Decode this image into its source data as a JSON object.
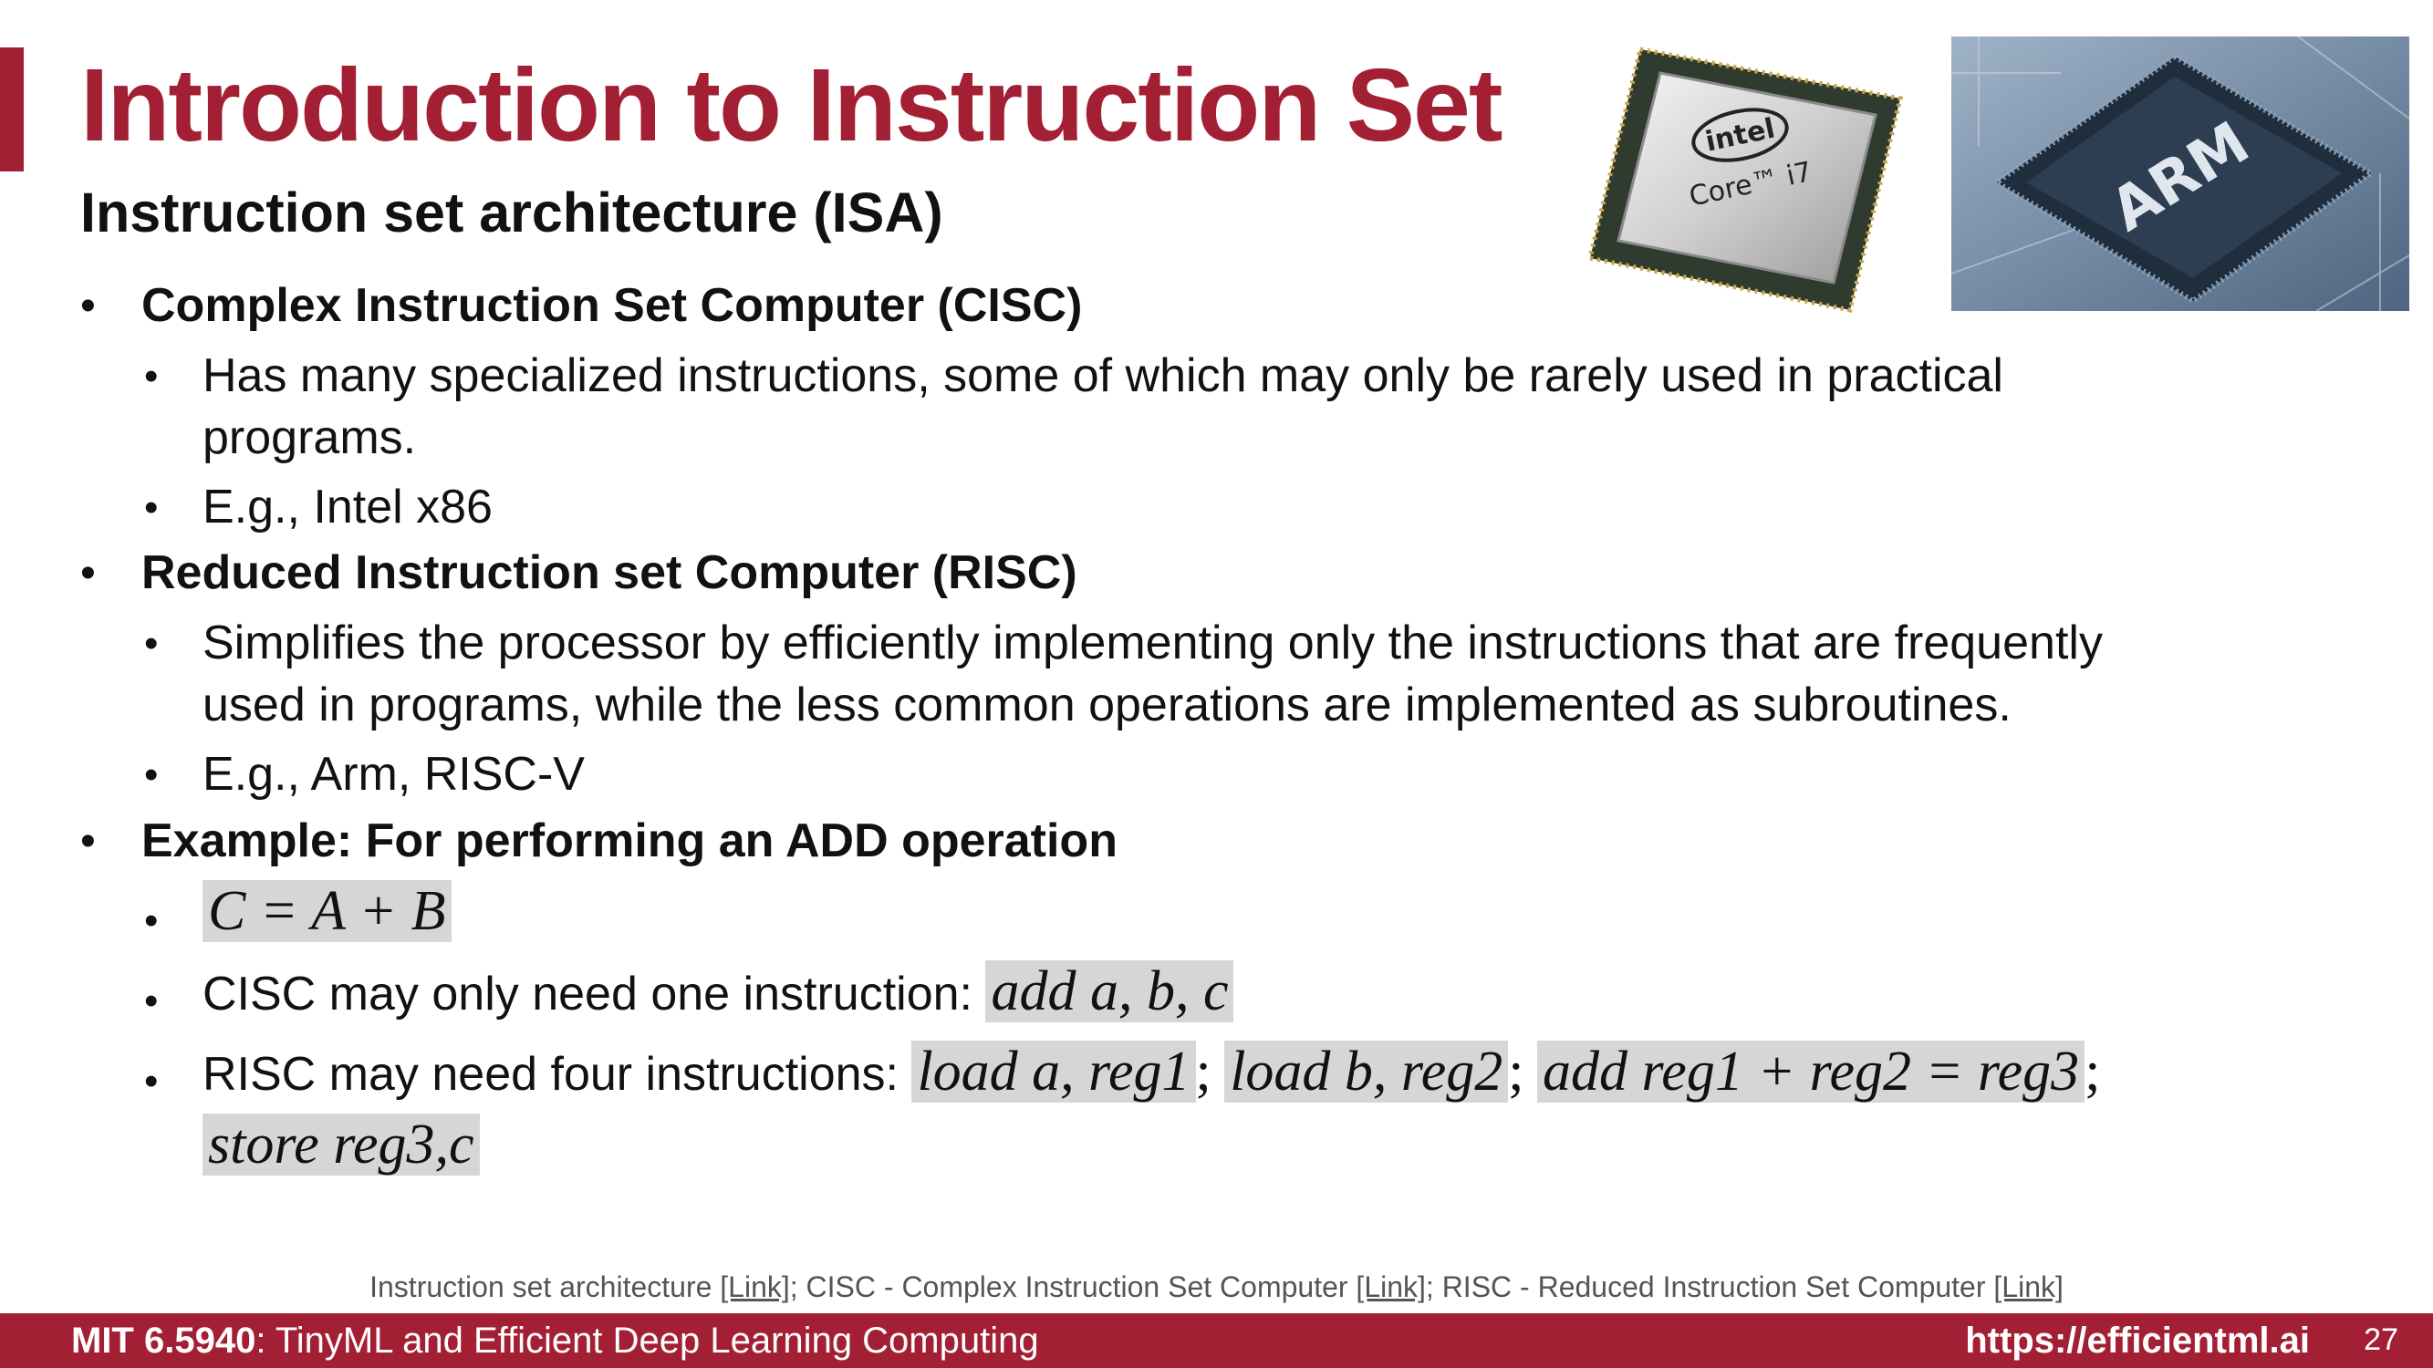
{
  "slide": {
    "title": "Introduction to Instruction Set",
    "subtitle": "Instruction set architecture (ISA)"
  },
  "images": {
    "intel_chip": {
      "brand": "intel",
      "model": "Core™ i7"
    },
    "arm_chip": {
      "brand": "ARM"
    }
  },
  "bullets": {
    "cisc": {
      "heading": "Complex Instruction Set Computer (CISC)",
      "desc_line1": "Has many specialized instructions, some of which may only be rarely used in practical",
      "desc_line2": "programs.",
      "example": "E.g., Intel x86"
    },
    "risc": {
      "heading": "Reduced Instruction set Computer (RISC)",
      "desc_line1": "Simplifies the processor by efficiently implementing only the instructions that are frequently",
      "desc_line2": "used in programs, while the less common operations are implemented as subroutines.",
      "example": "E.g., Arm, RISC-V"
    },
    "example": {
      "heading": "Example: For performing an ADD operation",
      "equation": "C = A + B",
      "cisc_text": "CISC may only need one instruction: ",
      "cisc_instr": "add a, b, c",
      "risc_text": "RISC may need four instructions: ",
      "risc_instr1": "load a, reg1",
      "risc_instr2": "load b, reg2",
      "risc_instr3": "add reg1 + reg2 = reg3",
      "risc_instr4": "store reg3,c",
      "separator": ";"
    }
  },
  "references": {
    "isa": "Instruction set architecture ",
    "cisc": "; CISC - Complex Instruction Set Computer ",
    "risc": "; RISC - Reduced Instruction Set Computer ",
    "link_label": "[Link]"
  },
  "footer": {
    "course_code": "MIT 6.5940",
    "course_name": ": TinyML and Efficient Deep Learning Computing",
    "url": "https://efficientml.ai",
    "page_number": "27"
  },
  "colors": {
    "accent": "#a31f34",
    "highlight": "#d6d6d6"
  }
}
